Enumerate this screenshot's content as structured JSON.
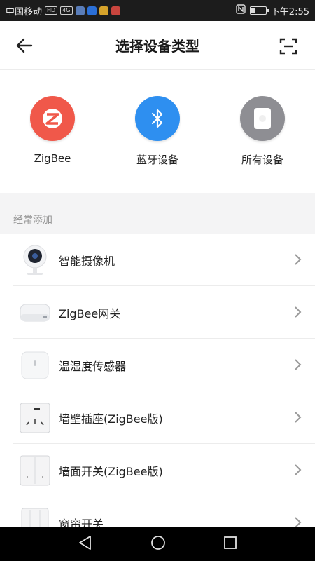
{
  "status_bar": {
    "carrier": "中国移动",
    "hd_badge": "HD",
    "network": "4G",
    "time": "下午2:55",
    "nfc_icon": "nfc-icon"
  },
  "header": {
    "title": "选择设备类型",
    "back_icon": "back-arrow-icon",
    "scan_icon": "scan-icon"
  },
  "categories": [
    {
      "label": "ZigBee",
      "icon": "zigbee-icon",
      "color": "#f0584a"
    },
    {
      "label": "蓝牙设备",
      "icon": "bluetooth-icon",
      "color": "#2e8ff0"
    },
    {
      "label": "所有设备",
      "icon": "all-devices-icon",
      "color": "#8e8e93"
    }
  ],
  "section": {
    "title": "经常添加"
  },
  "devices": [
    {
      "name": "智能摄像机",
      "icon": "camera-icon"
    },
    {
      "name": "ZigBee网关",
      "icon": "gateway-icon"
    },
    {
      "name": "温湿度传感器",
      "icon": "sensor-icon"
    },
    {
      "name": "墙壁插座(ZigBee版)",
      "icon": "wall-socket-icon"
    },
    {
      "name": "墙面开关(ZigBee版)",
      "icon": "wall-switch-icon"
    },
    {
      "name": "窗帘开关",
      "icon": "curtain-switch-icon"
    }
  ],
  "navbar": {
    "back": "nav-back-icon",
    "home": "nav-home-icon",
    "recents": "nav-recents-icon"
  }
}
